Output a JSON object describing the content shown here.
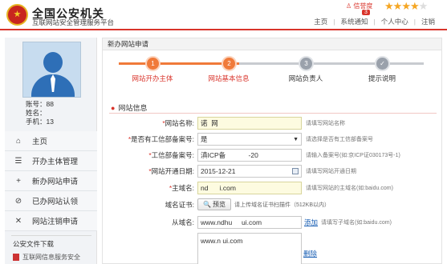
{
  "header": {
    "title": "全国公安机关",
    "subtitle": "互联网站安全管理服务平台",
    "trust_label": "信誉度",
    "notice_count": "3",
    "stars_filled": 4,
    "stars_total": 5,
    "nav": [
      "主页",
      "系统通知",
      "个人中心",
      "注销"
    ]
  },
  "sidebar": {
    "account": "账号：88",
    "name": "姓名：",
    "phone": "手机：13",
    "menu": [
      {
        "icon": "home-icon",
        "glyph": "⌂",
        "label": "主页"
      },
      {
        "icon": "list-icon",
        "glyph": "☰",
        "label": "开办主体管理"
      },
      {
        "icon": "plus-icon",
        "glyph": "+",
        "label": "新办网站申请"
      },
      {
        "icon": "ban-icon",
        "glyph": "⊘",
        "label": "已办网站认领"
      },
      {
        "icon": "close-icon",
        "glyph": "✕",
        "label": "网站注销申请"
      }
    ],
    "docs_title": "公安文件下载",
    "docs_item": "互联网信息服务安全"
  },
  "main": {
    "panel_title": "新办网站申请",
    "steps": [
      {
        "num": "1",
        "label": "网站开办主体",
        "done": true
      },
      {
        "num": "2",
        "label": "网站基本信息",
        "done": true
      },
      {
        "num": "3",
        "label": "网站负责人",
        "done": false
      },
      {
        "num": "✓",
        "label": "提示说明",
        "done": false
      }
    ],
    "section_title": "网站信息",
    "fields": {
      "site_name": {
        "label": "网站名称:",
        "value": "诺  网",
        "hint": "请填写网站名称"
      },
      "has_icp": {
        "label": "是否有工信部备案号:",
        "value": "是",
        "hint": "请选择是否有工信部备案号"
      },
      "icp_no": {
        "label": "工信部备案号:",
        "value": "滇ICP备            -20",
        "hint": "请输入备案号(如:京ICP证030173号-1)"
      },
      "open_date": {
        "label": "网站开通日期:",
        "value": "2015-12-21",
        "hint": "请填写网站开通日期"
      },
      "main_domain": {
        "label": "主域名:",
        "value": "nd      i.com",
        "hint": "请填写网站的主域名(如:baidu.com)"
      },
      "domain_cert": {
        "label": "域名证书:",
        "button": "预览",
        "hint": "请上传域名证书扫描件（512KB以内）"
      },
      "sub_domain": {
        "label": "从域名:",
        "value": "www.ndhu     ui.com",
        "add": "添加",
        "hint": "请填写子域名(如:baidu.com)"
      }
    },
    "domain_list": "www.n       ui.com",
    "delete_label": "删除"
  }
}
